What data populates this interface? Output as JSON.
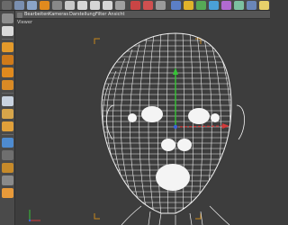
{
  "window": {
    "app": "Cinema 4D"
  },
  "menu": [
    {
      "label": "Bearbeiten"
    },
    {
      "label": "Kameras"
    },
    {
      "label": "Darstellung"
    },
    {
      "label": "Filter"
    },
    {
      "label": "Ansicht"
    }
  ],
  "viewport": {
    "label": "Viewer",
    "object": "head-wireframe-mesh"
  },
  "toolbar_icons": [
    "undo-icon",
    "move-icon",
    "scale-icon",
    "rotate-icon",
    "select-icon",
    "axis-x-icon",
    "axis-y-icon",
    "axis-z-icon",
    "coord-icon",
    "render-region-icon",
    "render-view-icon",
    "render-icon",
    "render-settings-icon",
    "cube-icon",
    "pen-icon",
    "subdivide-icon",
    "array-icon",
    "deformer-icon",
    "scene-icon",
    "camera-icon",
    "light-icon"
  ],
  "left_icons": [
    "make-editable-icon",
    "texture-icon",
    "model-mode-icon",
    "points-mode-icon",
    "edges-mode-icon",
    "polygons-mode-icon",
    "uv-icon",
    "texture-axis-icon",
    "workplane-icon",
    "snap-icon",
    "tweak-icon",
    "soft-select-icon",
    "checker-icon",
    "sculpt-icon",
    "material-icon"
  ],
  "colors": {
    "wire": "#f2f2f2",
    "y_axis": "#37c437",
    "x_axis": "#d33a3a",
    "frame": "#c7871b",
    "bg": "#3d3d3d"
  }
}
